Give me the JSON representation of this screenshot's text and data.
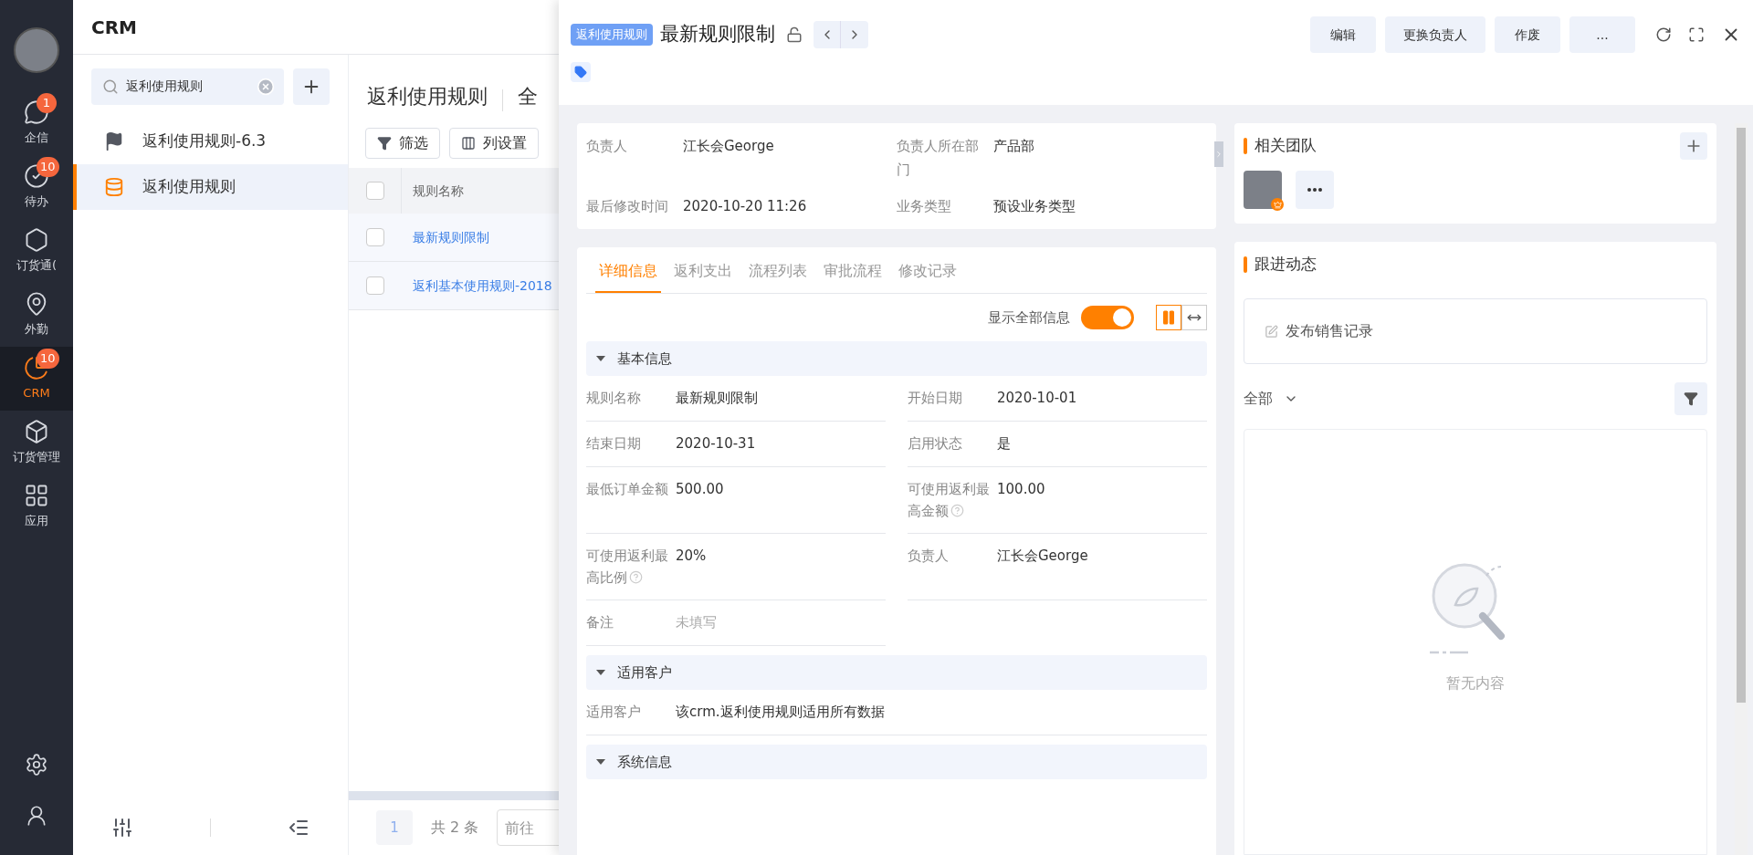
{
  "nav": [
    {
      "kind": "chat",
      "label": "企信",
      "badge": "1",
      "selected": false
    },
    {
      "kind": "todo",
      "label": "待办",
      "badge": "10",
      "selected": false
    },
    {
      "kind": "order",
      "label": "订货通(",
      "selected": false
    },
    {
      "kind": "field",
      "label": "外勤",
      "selected": false
    },
    {
      "kind": "crm",
      "label": "CRM",
      "badge": "10",
      "selected": true
    },
    {
      "kind": "box",
      "label": "订货管理",
      "selected": false
    },
    {
      "kind": "apps",
      "label": "应用",
      "selected": false
    }
  ],
  "module": {
    "title": "CRM",
    "search": {
      "value": "返利使用规则"
    },
    "items": [
      {
        "kind": "flag",
        "label": "返利使用规则-6.3",
        "selected": false
      },
      {
        "kind": "object",
        "label": "返利使用规则",
        "selected": true
      }
    ]
  },
  "list": {
    "title": "返利使用规则",
    "view": "全",
    "buttons": [
      {
        "kind": "filter",
        "label": "筛选"
      },
      {
        "kind": "columns",
        "label": "列设置"
      }
    ],
    "header_checked": false,
    "columns": [
      "规则名称"
    ],
    "rows": [
      {
        "name": "最新规则限制",
        "checked": false
      },
      {
        "name": "返利基本使用规则-2018",
        "checked": false
      }
    ],
    "pagination": {
      "page": "1",
      "total": "共 2 条",
      "goto_placeholder": "前往"
    }
  },
  "detail": {
    "tag": "返利使用规则",
    "title": "最新规则限制",
    "actions": [
      "编辑",
      "更换负责人",
      "作废",
      "..."
    ],
    "summary": [
      {
        "label": "负责人",
        "value": "江长会George"
      },
      {
        "label": "负责人所在部门",
        "value": "产品部"
      },
      {
        "label": "最后修改时间",
        "value": "2020-10-20 11:26"
      },
      {
        "label": "业务类型",
        "value": "预设业务类型"
      }
    ],
    "tabs": [
      {
        "label": "详细信息",
        "selected": true
      },
      {
        "label": "返利支出",
        "selected": false
      },
      {
        "label": "流程列表",
        "selected": false
      },
      {
        "label": "审批流程",
        "selected": false
      },
      {
        "label": "修改记录",
        "selected": false
      }
    ],
    "show_all": {
      "label": "显示全部信息",
      "on": true
    },
    "layouts": [
      {
        "kind": "two-column",
        "selected": true
      },
      {
        "kind": "full-width",
        "selected": false
      }
    ],
    "sections": [
      {
        "title": "基本信息",
        "expanded": true,
        "kind": "two-column",
        "fields": [
          {
            "label": "规则名称",
            "value": "最新规则限制",
            "help": false
          },
          {
            "label": "开始日期",
            "value": "2020-10-01",
            "help": false
          },
          {
            "label": "结束日期",
            "value": "2020-10-31",
            "help": false
          },
          {
            "label": "启用状态",
            "value": "是",
            "help": false
          },
          {
            "label": "最低订单金额",
            "value": "500.00",
            "help": false
          },
          {
            "label": "可使用返利最高金额",
            "value": "100.00",
            "help": true
          },
          {
            "label": "可使用返利最高比例",
            "value": "20%",
            "help": true
          },
          {
            "label": "负责人",
            "value": "江长会George",
            "help": false
          },
          {
            "label": "备注",
            "placeholder": "未填写",
            "help": false
          }
        ]
      },
      {
        "title": "适用客户",
        "expanded": true,
        "kind": "one-column",
        "fields": [
          {
            "label": "适用客户",
            "value": "该crm.返利使用规则适用所有数据",
            "help": false
          }
        ]
      },
      {
        "title": "系统信息",
        "expanded": true
      }
    ]
  },
  "team": {
    "title": "相关团队"
  },
  "feed": {
    "title": "跟进动态",
    "compose": "发布销售记录",
    "filter": "全部",
    "empty": "暂无内容"
  }
}
